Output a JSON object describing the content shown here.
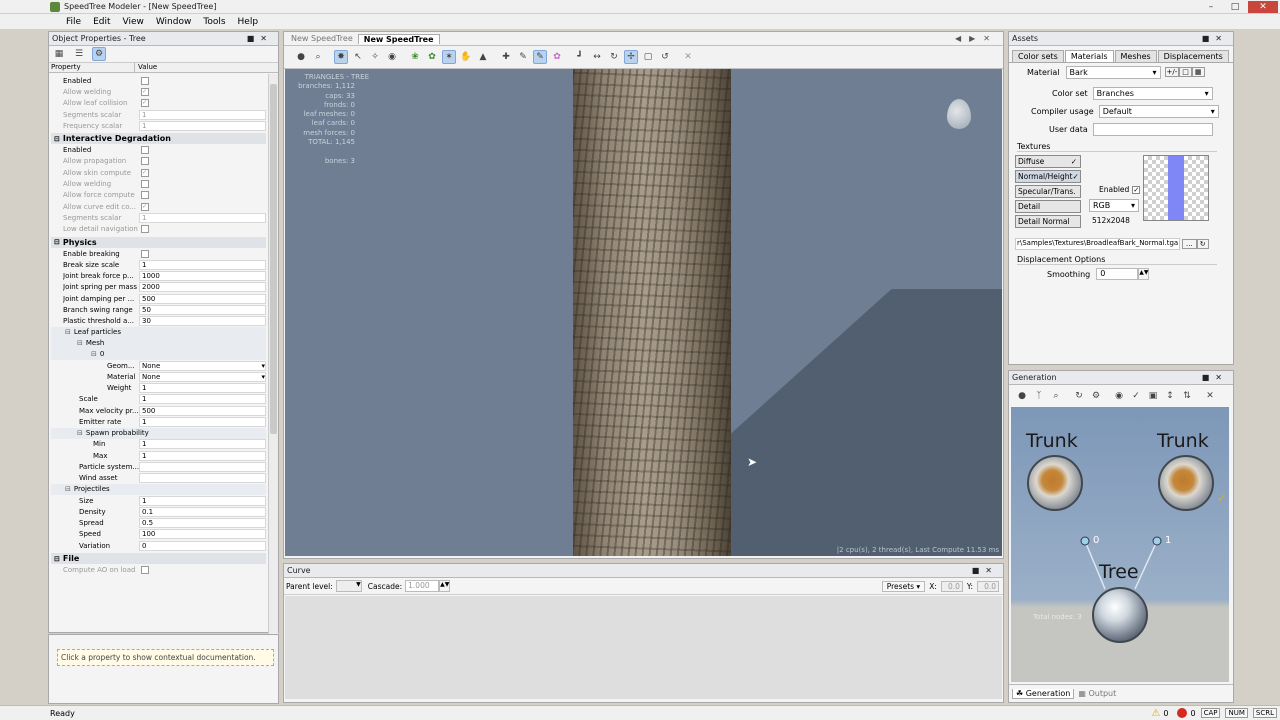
{
  "window": {
    "title": "SpeedTree Modeler - [New SpeedTree]"
  },
  "menu": [
    "File",
    "Edit",
    "View",
    "Window",
    "Tools",
    "Help"
  ],
  "object_properties": {
    "title": "Object Properties - Tree",
    "col_property": "Property",
    "col_value": "Value",
    "rows_top": [
      {
        "label": "Enabled",
        "type": "check",
        "disabled": false
      },
      {
        "label": "Allow welding",
        "type": "check",
        "disabled": true,
        "checked": true
      },
      {
        "label": "Allow leaf collision",
        "type": "check",
        "disabled": true,
        "checked": true
      },
      {
        "label": "Segments scalar",
        "value": "1",
        "disabled": true
      },
      {
        "label": "Frequency scalar",
        "value": "1",
        "disabled": true
      }
    ],
    "interactive_degradation": {
      "label": "Interactive Degradation",
      "rows": [
        {
          "label": "Enabled",
          "type": "check",
          "disabled": false
        },
        {
          "label": "Allow propagation",
          "type": "check",
          "disabled": true
        },
        {
          "label": "Allow skin compute",
          "type": "check",
          "disabled": true,
          "checked": true
        },
        {
          "label": "Allow welding",
          "type": "check",
          "disabled": true
        },
        {
          "label": "Allow force compute",
          "type": "check",
          "disabled": true
        },
        {
          "label": "Allow curve edit co...",
          "type": "check",
          "disabled": true,
          "checked": true
        },
        {
          "label": "Segments scalar",
          "value": "1",
          "disabled": true
        },
        {
          "label": "Low detail navigation",
          "type": "check",
          "disabled": true
        }
      ]
    },
    "physics": {
      "label": "Physics",
      "rows": [
        {
          "label": "Enable breaking",
          "type": "check"
        },
        {
          "label": "Break size scale",
          "value": "1"
        },
        {
          "label": "Joint break force p...",
          "value": "1000"
        },
        {
          "label": "Joint spring per mass",
          "value": "2000"
        },
        {
          "label": "Joint damping per ...",
          "value": "500"
        },
        {
          "label": "Branch swing range",
          "value": "50"
        },
        {
          "label": "Plastic threshold a...",
          "value": "30"
        }
      ],
      "leaf_particles": "Leaf particles",
      "mesh": "Mesh",
      "mesh_index": "0",
      "mesh_rows": [
        {
          "label": "Geom...",
          "value": "None",
          "dropdown": true
        },
        {
          "label": "Material",
          "value": "None",
          "dropdown": true
        },
        {
          "label": "Weight",
          "value": "1"
        }
      ],
      "lp_rows": [
        {
          "label": "Scale",
          "value": "1"
        },
        {
          "label": "Max velocity pr...",
          "value": "500"
        },
        {
          "label": "Emitter rate",
          "value": "1"
        }
      ],
      "spawn_probability": "Spawn probability",
      "spawn_rows": [
        {
          "label": "Min",
          "value": "1"
        },
        {
          "label": "Max",
          "value": "1"
        }
      ],
      "lp_rows2": [
        {
          "label": "Particle system...",
          "value": ""
        },
        {
          "label": "Wind asset",
          "value": ""
        }
      ],
      "projectiles": "Projectiles",
      "proj_rows": [
        {
          "label": "Size",
          "value": "1"
        },
        {
          "label": "Density",
          "value": "0.1"
        },
        {
          "label": "Spread",
          "value": "0.5"
        },
        {
          "label": "Speed",
          "value": "100"
        },
        {
          "label": "Variation",
          "value": "0"
        }
      ]
    },
    "file": {
      "label": "File",
      "rows": [
        {
          "label": "Compute AO on load",
          "type": "check",
          "disabled": true
        }
      ]
    },
    "help_text": "Click a property to show contextual documentation."
  },
  "viewport": {
    "tabs": [
      "New SpeedTree",
      "New SpeedTree"
    ],
    "stats": [
      "TRIANGLES - TREE",
      "branches: 1,112",
      "caps: 33",
      "fronds: 0",
      "leaf meshes: 0",
      "leaf cards: 0",
      "mesh forces: 0",
      "TOTAL: 1,145",
      "",
      "bones: 3"
    ],
    "compute_info": "2 cpu(s), 2 thread(s), Last Compute 11.53 ms"
  },
  "curve": {
    "title": "Curve",
    "parent_level_label": "Parent level:",
    "cascade_label": "Cascade:",
    "cascade_value": "1.000",
    "presets_label": "Presets",
    "x_label": "X:",
    "x_value": "0.0",
    "y_label": "Y:",
    "y_value": "0.0"
  },
  "assets": {
    "title": "Assets",
    "tabs": [
      "Color sets",
      "Materials",
      "Meshes",
      "Displacements"
    ],
    "material_label": "Material",
    "material_value": "Bark",
    "color_set_label": "Color set",
    "color_set_value": "Branches",
    "compiler_usage_label": "Compiler usage",
    "compiler_usage_value": "Default",
    "user_data_label": "User data",
    "textures_label": "Textures",
    "tex_buttons": [
      "Diffuse",
      "Normal/Height",
      "Specular/Trans.",
      "Detail",
      "Detail Normal"
    ],
    "enabled_label": "Enabled",
    "format_value": "RGB",
    "size_value": "512x2048",
    "path_value": "r\\Samples\\Textures\\BroadleafBark_Normal.tga",
    "browse_label": "...",
    "displacement_label": "Displacement Options",
    "smoothing_label": "Smoothing",
    "smoothing_value": "0"
  },
  "generation": {
    "title": "Generation",
    "nodes": [
      {
        "label": "Trunk"
      },
      {
        "label": "Trunk"
      },
      {
        "label": "Tree"
      }
    ],
    "port0": "0",
    "port1": "1",
    "total_nodes": "Total nodes: 3",
    "tabs": [
      "Generation",
      "Output"
    ]
  },
  "statusbar": {
    "text": "Ready",
    "warnings": "0",
    "errors": "0",
    "indicators": [
      "CAP",
      "NUM",
      "SCRL"
    ]
  },
  "colors": {
    "viewport_bg": "#6f7e92",
    "texture_accent": "#7f86f5"
  }
}
